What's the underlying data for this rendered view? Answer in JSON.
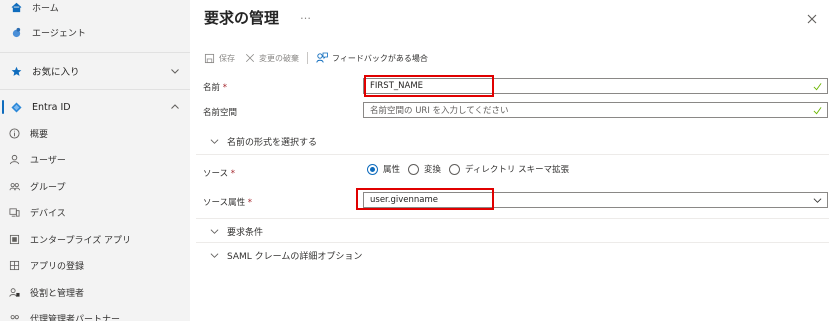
{
  "sidebar": {
    "items": [
      {
        "label": "ホーム",
        "icon": "home-icon"
      },
      {
        "label": "エージェント",
        "icon": "agent-icon"
      },
      {
        "label": "お気に入り",
        "icon": "star-icon"
      },
      {
        "label": "Entra ID",
        "icon": "entra-id-icon"
      },
      {
        "label": "概要",
        "icon": "info-icon"
      },
      {
        "label": "ユーザー",
        "icon": "user-icon"
      },
      {
        "label": "グループ",
        "icon": "group-icon"
      },
      {
        "label": "デバイス",
        "icon": "device-icon"
      },
      {
        "label": "エンタープライズ アプリ",
        "icon": "enterprise-app-icon"
      },
      {
        "label": "アプリの登録",
        "icon": "app-registration-icon"
      },
      {
        "label": "役割と管理者",
        "icon": "roles-admins-icon"
      },
      {
        "label": "代理管理者パートナー",
        "icon": "partner-icon"
      }
    ]
  },
  "header": {
    "title": "要求の管理",
    "more": "…"
  },
  "toolbar": {
    "save": "保存",
    "discard": "変更の破棄",
    "feedback": "フィードバックがある場合"
  },
  "form": {
    "name_label": "名前",
    "name_value": "FIRST_NAME",
    "namespace_label": "名前空間",
    "namespace_placeholder": "名前空間の URI を入力してください",
    "name_format_section": "名前の形式を選択する",
    "source_label": "ソース",
    "source_options": [
      "属性",
      "変換",
      "ディレクトリ スキーマ拡張"
    ],
    "source_selected": "属性",
    "source_attr_label": "ソース属性",
    "source_attr_value": "user.givenname",
    "conditions_section": "要求条件",
    "saml_section": "SAML クレームの詳細オプション",
    "required_mark": "*"
  },
  "colors": {
    "accent": "#0f6cbd",
    "highlight": "#e00000",
    "valid": "#6bb700",
    "required": "#a4262c"
  }
}
